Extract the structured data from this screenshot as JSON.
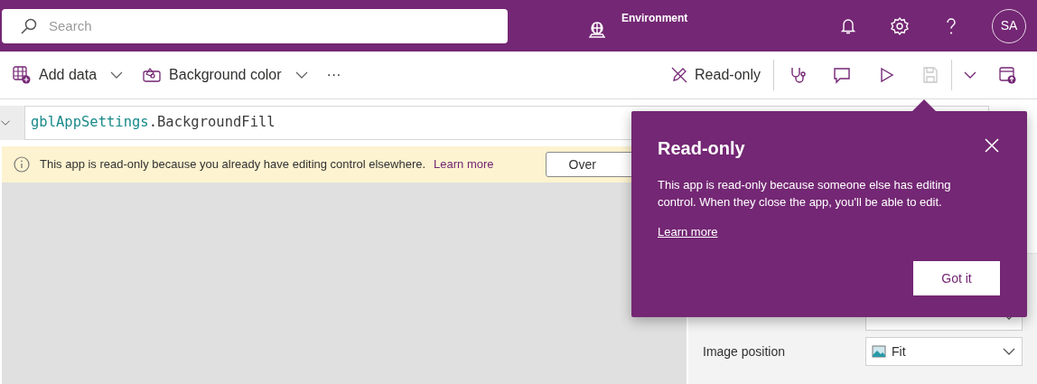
{
  "header": {
    "search": {
      "placeholder": "Search"
    },
    "environment": {
      "label": "Environment"
    },
    "avatar": {
      "initials": "SA"
    }
  },
  "toolbar": {
    "left": [
      {
        "kind": "add-data",
        "label": "Add data",
        "dropdown": true
      },
      {
        "kind": "background",
        "label": "Background color",
        "dropdown": true
      },
      {
        "kind": "more",
        "label": "···",
        "dropdown": false
      }
    ],
    "mode": {
      "label": "Read-only"
    },
    "actions": [
      {
        "kind": "checker",
        "disabled": false
      },
      {
        "kind": "comments",
        "disabled": false
      },
      {
        "kind": "play",
        "disabled": false
      },
      {
        "kind": "save",
        "disabled": true
      }
    ]
  },
  "formula": {
    "variable": "gblAppSettings",
    "property": ".BackgroundFill"
  },
  "notice": {
    "text": "This app is read-only because you already have editing control elsewhere.",
    "link": "Learn more",
    "button": "Over"
  },
  "properties": [
    {
      "label": "Image position",
      "value": "Fit"
    }
  ],
  "popup": {
    "title": "Read-only",
    "body": "This app is read-only because someone else has editing control. When they close the app, you'll be able to edit.",
    "link": "Learn more",
    "button": "Got it"
  }
}
